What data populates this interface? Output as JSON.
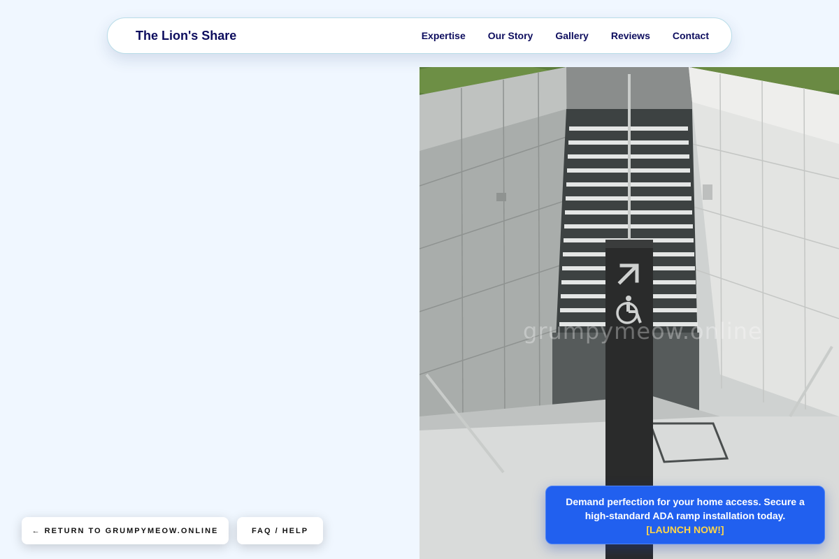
{
  "brand": {
    "name": "The Lion's Share"
  },
  "nav": {
    "items": [
      {
        "label": "Expertise"
      },
      {
        "label": "Our Story"
      },
      {
        "label": "Gallery"
      },
      {
        "label": "Reviews"
      },
      {
        "label": "Contact"
      }
    ]
  },
  "hero": {
    "watermark": "grumpymeow.online",
    "sign_icons": [
      "arrow-up-right-icon",
      "wheelchair-icon"
    ]
  },
  "footer_buttons": {
    "return_label": "← RETURN TO GRUMPYMEOW.ONLINE",
    "faq_label": "FAQ / HELP"
  },
  "cta": {
    "text": "Demand perfection for your home access. Secure a high-standard ADA ramp installation today.",
    "link_label": "[LAUNCH NOW!]"
  },
  "colors": {
    "page_bg": "#f0f7ff",
    "nav_text": "#0d0d5e",
    "cta_bg": "#2160ef",
    "cta_link": "#ffd54a"
  }
}
